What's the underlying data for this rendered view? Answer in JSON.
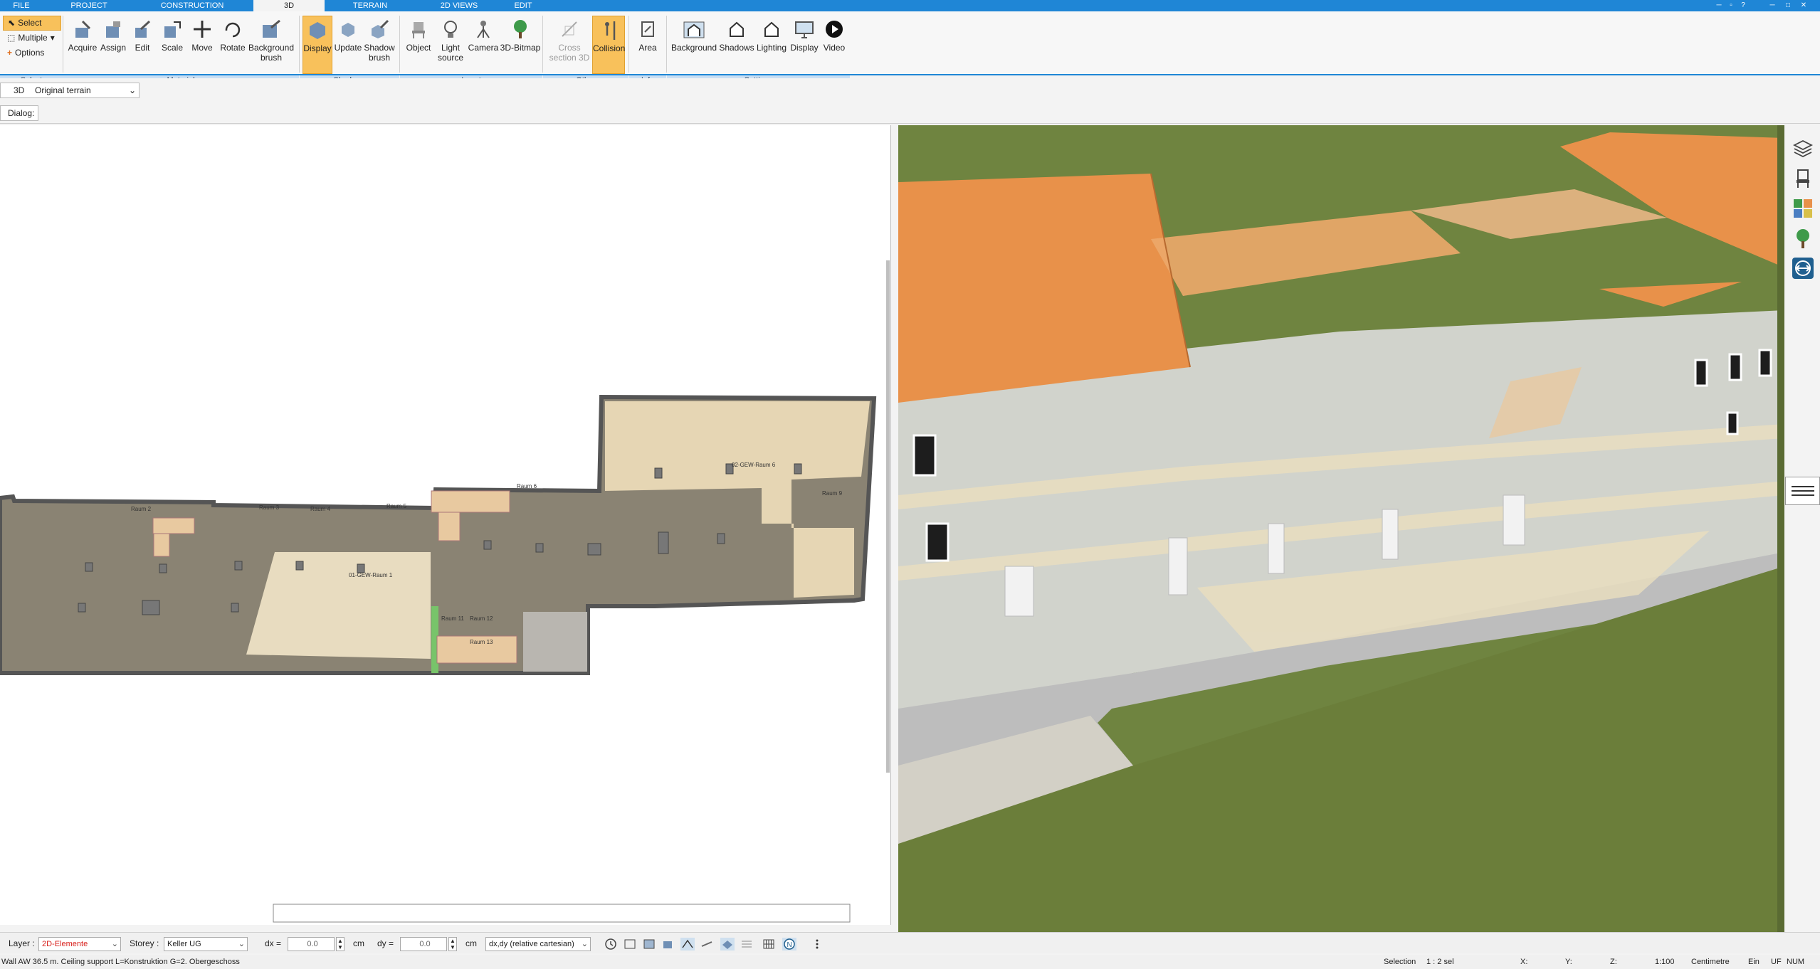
{
  "tabs": [
    "FILE",
    "PROJECT",
    "CONSTRUCTION",
    "3D",
    "TERRAIN",
    "2D VIEWS",
    "EDIT"
  ],
  "select_group": {
    "select": "Select",
    "multiple": "Multiple",
    "options": "Options",
    "label": "Select"
  },
  "ribbon": {
    "material": [
      "Acquire",
      "Assign",
      "Edit",
      "Scale",
      "Move",
      "Rotate",
      "Background brush"
    ],
    "shadows": [
      "Display",
      "Update",
      "Shadow brush"
    ],
    "insert": [
      "Object",
      "Light source",
      "Camera",
      "3D-Bitmap"
    ],
    "other": [
      "Cross section 3D",
      "Collision"
    ],
    "info": [
      "Area"
    ],
    "settings": [
      "Background",
      "Shadows",
      "Lighting",
      "Display",
      "Video"
    ]
  },
  "group_labels": {
    "material": "Material",
    "shadows": "Shadows",
    "insert": "Insert",
    "other": "Other",
    "info": "Info",
    "settings": "Settings"
  },
  "viewbar": {
    "mode": "3D",
    "terrain": "Original terrain"
  },
  "dialog_label": "Dialog:",
  "plan_rooms": [
    "Raum 2",
    "Raum 3",
    "Raum 4",
    "Raum 5",
    "Raum 6",
    "01-GEW-Raum 1",
    "02-GEW-Raum 6",
    "Raum 9",
    "Raum 11",
    "Raum 12",
    "Raum 13"
  ],
  "statusbar": {
    "layer_label": "Layer :",
    "layer_value": "2D-Elemente",
    "storey_label": "Storey :",
    "storey_value": "Keller UG",
    "dx_label": "dx =",
    "dx_value": "0.0",
    "dx_unit": "cm",
    "dy_label": "dy =",
    "dy_value": "0.0",
    "dy_unit": "cm",
    "coord_mode": "dx,dy (relative cartesian)"
  },
  "status_line": {
    "message": "Wall AW 36.5 m. Ceiling support L=Konstruktion G=2. Obergeschoss",
    "selection_label": "Selection",
    "selection_value": "1 : 2 sel",
    "x": "X:",
    "y": "Y:",
    "z": "Z:",
    "scale": "1:100",
    "unit": "Centimetre",
    "ein": "Ein",
    "uf": "UF",
    "num": "NUM"
  },
  "colors": {
    "accent": "#1f86d6",
    "active": "#f8c15b",
    "roof": "#e8904a",
    "grass": "#6b7e3a"
  }
}
